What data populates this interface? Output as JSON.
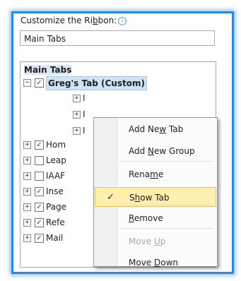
{
  "label": {
    "prefix": "Customize the Ri",
    "accel": "b",
    "suffix": "bon:"
  },
  "combo_value": "Main Tabs",
  "tree": {
    "title": "Main Tabs",
    "custom_tab": {
      "label": "Greg's Tab (Custom)",
      "checked": true
    },
    "custom_children": [
      "I",
      "I",
      "I"
    ],
    "items": [
      {
        "label": "Hom",
        "checked": true
      },
      {
        "label": "Leap",
        "checked": false
      },
      {
        "label": "IAAF",
        "checked": false
      },
      {
        "label": "Inse",
        "checked": true
      },
      {
        "label": "Page",
        "checked": true
      },
      {
        "label": "Refe",
        "checked": true
      },
      {
        "label": "Mail",
        "checked": true
      }
    ]
  },
  "menu": {
    "items": [
      {
        "before": "Add Ne",
        "accel": "w",
        "after": " Tab",
        "enabled": true,
        "selected": false,
        "checked": false
      },
      {
        "before": "Add ",
        "accel": "N",
        "after": "ew Group",
        "enabled": true,
        "selected": false,
        "checked": false
      },
      {
        "before": "Rena",
        "accel": "m",
        "after": "e",
        "enabled": true,
        "selected": false,
        "checked": false
      },
      {
        "before": "S",
        "accel": "h",
        "after": "ow Tab",
        "enabled": true,
        "selected": true,
        "checked": true
      },
      {
        "before": "",
        "accel": "R",
        "after": "emove",
        "enabled": true,
        "selected": false,
        "checked": false
      },
      {
        "before": "Move ",
        "accel": "U",
        "after": "p",
        "enabled": false,
        "selected": false,
        "checked": false
      },
      {
        "before": "Move ",
        "accel": "D",
        "after": "own",
        "enabled": true,
        "selected": false,
        "checked": false
      }
    ],
    "checkmark": "✓"
  }
}
